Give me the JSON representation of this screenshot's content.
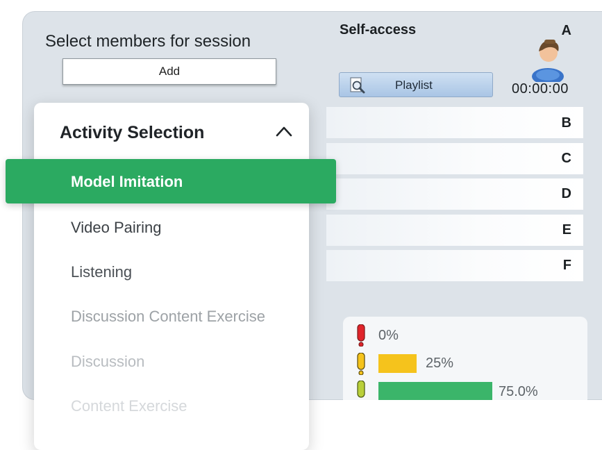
{
  "members": {
    "title": "Select members for session",
    "add_label": "Add"
  },
  "session": {
    "title": "Self-access",
    "playlist_label": "Playlist",
    "timer": "00:00:00",
    "rows": [
      "A",
      "B",
      "C",
      "D",
      "E",
      "F"
    ]
  },
  "stats": [
    {
      "label": "0%",
      "value": 0,
      "color": "#e0242b"
    },
    {
      "label": "25%",
      "value": 25,
      "color": "#f5c31c"
    },
    {
      "label": "75.0%",
      "value": 75,
      "color": "#3bb56a"
    }
  ],
  "activity": {
    "title": "Activity Selection",
    "selected": "Model Imitation",
    "options": [
      {
        "label": "Video Pairing",
        "color": "#3b4045"
      },
      {
        "label": "Listening",
        "color": "#4b5055"
      },
      {
        "label": "Discussion Content Exercise",
        "color": "#9da2a6"
      },
      {
        "label": "Discussion",
        "color": "#b8bcc0"
      },
      {
        "label": "Content Exercise",
        "color": "#d5d8db"
      }
    ]
  },
  "icons": {
    "playlist": "magnifier-document-icon",
    "avatar": "user-avatar-icon",
    "collapse": "chevron-up-icon",
    "stat": "traffic-indicator-icon"
  }
}
